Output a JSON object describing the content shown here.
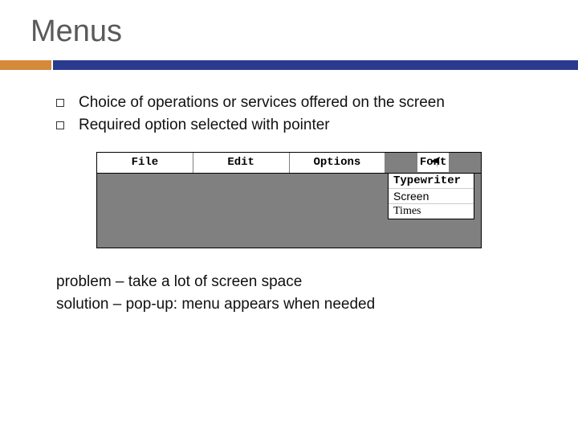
{
  "title": "Menus",
  "bullets": [
    "Choice of operations or services offered on the screen",
    "Required option selected with pointer"
  ],
  "menu": {
    "items": [
      "File",
      "Edit",
      "Options",
      "Font"
    ],
    "selected_index": 3,
    "dropdown": [
      "Typewriter",
      "Screen",
      "Times"
    ]
  },
  "notes": {
    "problem": "problem – take a lot of screen space",
    "solution": "solution – pop-up: menu appears when needed"
  }
}
